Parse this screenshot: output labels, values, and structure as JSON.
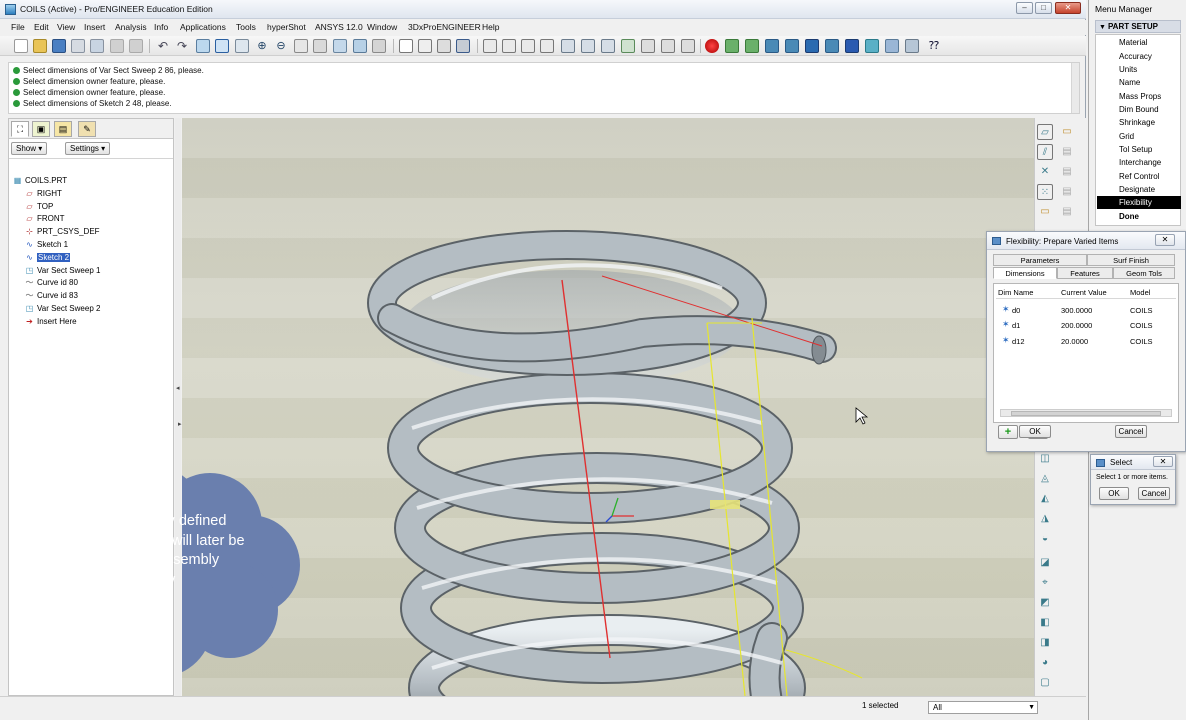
{
  "window": {
    "title": "COILS (Active) - Pro/ENGINEER Education Edition",
    "controls": [
      "–",
      "□",
      "✕"
    ]
  },
  "menu": [
    "File",
    "Edit",
    "View",
    "Insert",
    "Analysis",
    "Info",
    "Applications",
    "Tools",
    "hyperShot",
    "ANSYS 12.0",
    "Window",
    "3DxProENGINEER",
    "Help"
  ],
  "messages": [
    "Select dimensions of Var Sect Sweep 2 86, please.",
    "Select dimension owner feature, please.",
    "Select dimension owner feature, please.",
    "Select dimensions of Sketch 2 48, please."
  ],
  "model_tree": {
    "show_label": "Show",
    "settings_label": "Settings",
    "root": "COILS.PRT",
    "items": [
      {
        "label": "RIGHT",
        "icon": "datum-plane-icon"
      },
      {
        "label": "TOP",
        "icon": "datum-plane-icon"
      },
      {
        "label": "FRONT",
        "icon": "datum-plane-icon"
      },
      {
        "label": "PRT_CSYS_DEF",
        "icon": "csys-icon"
      },
      {
        "label": "Sketch 1",
        "icon": "sketch-icon"
      },
      {
        "label": "Sketch 2",
        "icon": "sketch-icon",
        "selected": true
      },
      {
        "label": "Var Sect Sweep 1",
        "icon": "sweep-icon"
      },
      {
        "label": "Curve id 80",
        "icon": "curve-icon"
      },
      {
        "label": "Curve id 83",
        "icon": "curve-icon"
      },
      {
        "label": "Var Sect Sweep 2",
        "icon": "sweep-icon"
      },
      {
        "label": "Insert Here",
        "icon": "insert-arrow-icon"
      }
    ]
  },
  "viewport": {
    "annotation": "all of these newly defined flexible dimensions will later be driven by the assembly geometry"
  },
  "status_bar": {
    "selected": "1 selected",
    "filter": "All"
  },
  "menu_manager": {
    "title": "Menu Manager",
    "header": "PART SETUP",
    "items": [
      "Material",
      "Accuracy",
      "Units",
      "Name",
      "Mass Props",
      "Dim Bound",
      "Shrinkage",
      "Grid",
      "Tol Setup",
      "Interchange",
      "Ref Control",
      "Designate",
      "Flexibility",
      "Done"
    ],
    "highlighted": "Flexibility"
  },
  "flex_dialog": {
    "title": "Flexibility: Prepare Varied Items",
    "tabs_top": [
      "Parameters",
      "Surf Finish"
    ],
    "tabs_bottom": [
      "Dimensions",
      "Features",
      "Geom Tols"
    ],
    "active_tab": "Dimensions",
    "columns": [
      "Dim Name",
      "Current Value",
      "Model"
    ],
    "rows": [
      {
        "name": "d0",
        "value": "300.0000",
        "model": "COILS"
      },
      {
        "name": "d1",
        "value": "200.0000",
        "model": "COILS"
      },
      {
        "name": "d12",
        "value": "20.0000",
        "model": "COILS"
      }
    ],
    "ok": "OK",
    "cancel": "Cancel"
  },
  "select_dialog": {
    "title": "Select",
    "prompt": "Select 1 or more items.",
    "ok": "OK",
    "cancel": "Cancel"
  },
  "colors": {
    "accent": "#3060c0",
    "bubble": "#6a7fae",
    "spring": "#b4bdc3"
  }
}
